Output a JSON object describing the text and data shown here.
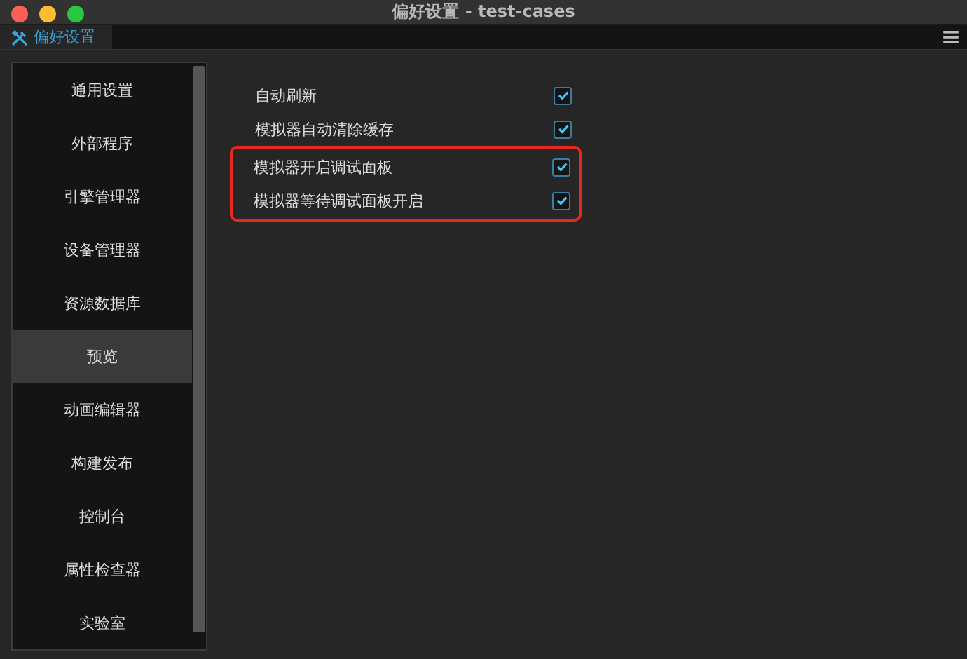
{
  "window": {
    "title": "偏好设置 - test-cases"
  },
  "tabs": [
    {
      "label": "偏好设置",
      "selected": true
    }
  ],
  "sidebar": {
    "items": [
      {
        "label": "通用设置",
        "selected": false
      },
      {
        "label": "外部程序",
        "selected": false
      },
      {
        "label": "引擎管理器",
        "selected": false
      },
      {
        "label": "设备管理器",
        "selected": false
      },
      {
        "label": "资源数据库",
        "selected": false
      },
      {
        "label": "预览",
        "selected": true
      },
      {
        "label": "动画编辑器",
        "selected": false
      },
      {
        "label": "构建发布",
        "selected": false
      },
      {
        "label": "控制台",
        "selected": false
      },
      {
        "label": "属性检查器",
        "selected": false
      },
      {
        "label": "实验室",
        "selected": false
      }
    ]
  },
  "groups": [
    {
      "highlighted": false,
      "settings": [
        {
          "label": "自动刷新",
          "checked": true
        },
        {
          "label": "模拟器自动清除缓存",
          "checked": true
        }
      ]
    },
    {
      "highlighted": true,
      "settings": [
        {
          "label": "模拟器开启调试面板",
          "checked": true
        },
        {
          "label": "模拟器等待调试面板开启",
          "checked": true
        }
      ]
    }
  ]
}
